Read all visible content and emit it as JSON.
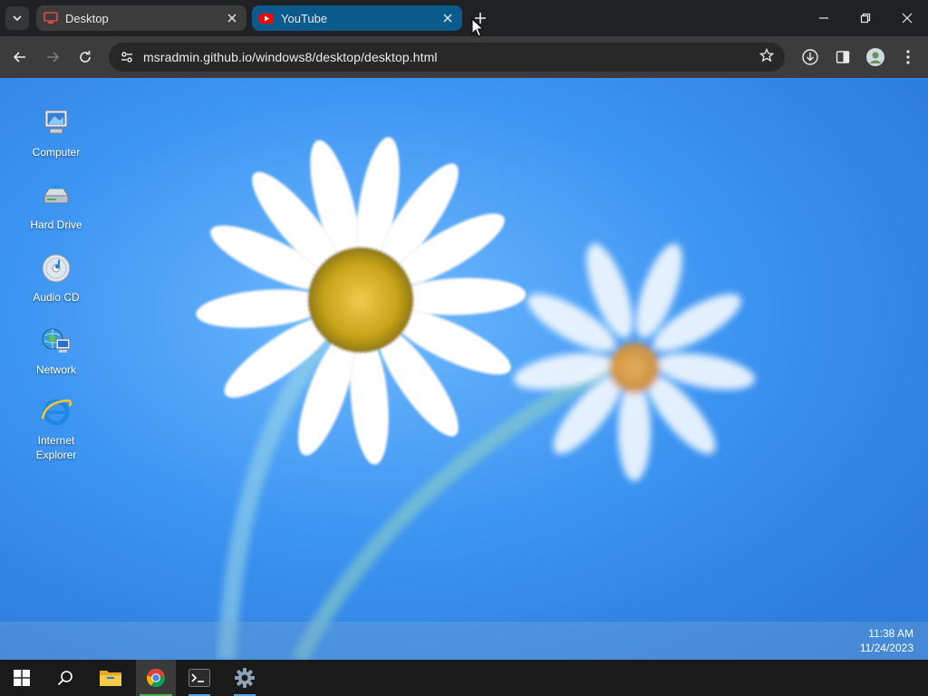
{
  "browser": {
    "tabs": [
      {
        "title": "Desktop",
        "favicon": "monitor-icon",
        "active": true
      },
      {
        "title": "YouTube",
        "favicon": "youtube-icon",
        "active": false
      }
    ],
    "address": "msradmin.github.io/windows8/desktop/desktop.html",
    "colors": {
      "tab_youtube": "#0b5a8c",
      "youtube_red": "#ff0000",
      "desktop_favicon": "#e04b4b"
    }
  },
  "desktop": {
    "icons": [
      {
        "label": "Computer",
        "icon": "computer-icon"
      },
      {
        "label": "Hard Drive",
        "icon": "hard-drive-icon"
      },
      {
        "label": "Audio CD",
        "icon": "audio-cd-icon"
      },
      {
        "label": "Network",
        "icon": "network-icon"
      },
      {
        "label": "Internet Explorer",
        "icon": "internet-explorer-icon"
      }
    ],
    "clock": {
      "time": "11:38 AM",
      "date": "11/24/2023"
    }
  },
  "taskbar": {
    "items": [
      {
        "name": "start",
        "icon": "windows-logo-icon"
      },
      {
        "name": "search",
        "icon": "search-icon"
      },
      {
        "name": "file-explorer",
        "icon": "folder-icon"
      },
      {
        "name": "chrome",
        "icon": "chrome-icon",
        "active": true
      },
      {
        "name": "terminal",
        "icon": "terminal-icon"
      },
      {
        "name": "settings",
        "icon": "gear-icon"
      }
    ]
  }
}
